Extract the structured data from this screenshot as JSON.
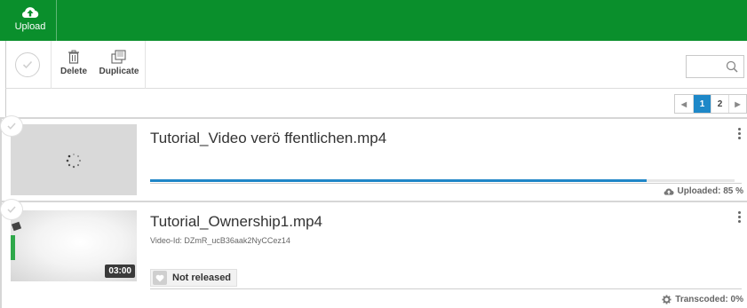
{
  "topbar": {
    "upload_label": "Upload",
    "brand_color": "#0a8f2c"
  },
  "toolbar": {
    "delete_label": "Delete",
    "duplicate_label": "Duplicate",
    "icons": [
      "check-icon",
      "trash-icon",
      "duplicate-icon",
      "search-icon"
    ]
  },
  "pagination": {
    "pages": [
      "1",
      "2"
    ],
    "current": "1",
    "accent_color": "#1e88c8"
  },
  "videos": [
    {
      "title": "Tutorial_Video verö ffentlichen.mp4",
      "status": "Uploaded: 85 %",
      "upload_progress": 0.85,
      "thumbnail": "loading-spinner"
    },
    {
      "title": "Tutorial_Ownership1.mp4",
      "video_id": "Video-Id: DZmR_ucB36aak2NyCCez14",
      "duration": "03:00",
      "release_status": "Not released",
      "status": "Transcoded: 0%"
    }
  ]
}
